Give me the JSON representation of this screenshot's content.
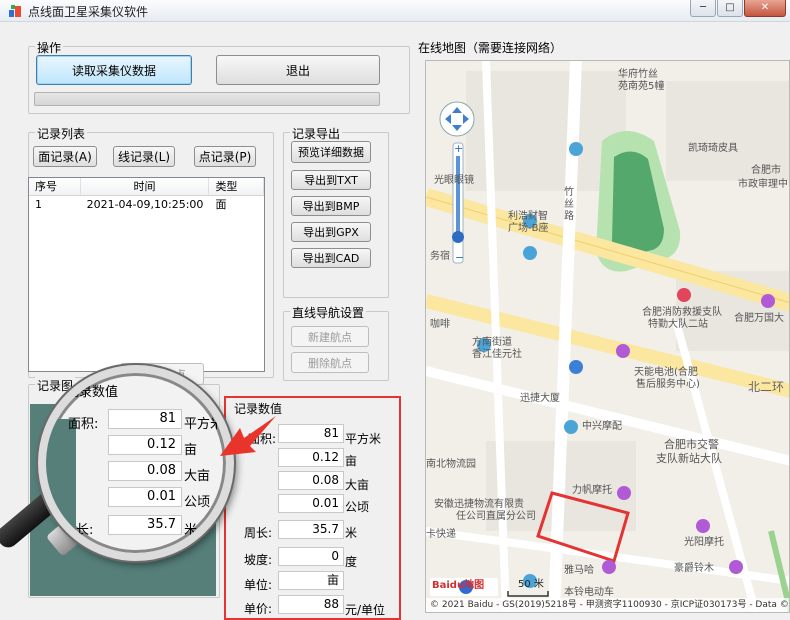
{
  "window": {
    "title": "点线面卫星采集仪软件",
    "minimize": "─",
    "maximize": "□",
    "close": "✕"
  },
  "operation": {
    "label": "操作",
    "read_button": "读取采集仪数据",
    "exit_button": "退出",
    "progress": 0
  },
  "record_list": {
    "label": "记录列表",
    "buttons": [
      "面记录(A)",
      "线记录(L)",
      "点记录(P)"
    ],
    "columns": [
      "序号",
      "时间",
      "类型"
    ],
    "rows": [
      {
        "id": "1",
        "time": "2021-04-09,10:25:00",
        "type": "面"
      }
    ]
  },
  "record_export": {
    "label": "记录导出",
    "buttons": [
      "预览详细数据",
      "导出到TXT",
      "导出到BMP",
      "导出到GPX",
      "导出到CAD"
    ]
  },
  "navigation": {
    "label": "直线导航设置",
    "new_waypoint": "新建航点",
    "delete_waypoint": "删除航点"
  },
  "record_image": {
    "label": "记录图"
  },
  "record_values": {
    "label": "记录数值",
    "area": {
      "label": "面积:",
      "value": "81",
      "unit": "平方米"
    },
    "mu1": {
      "value": "0.12",
      "unit": "亩"
    },
    "big_mu": {
      "value": "0.08",
      "unit": "大亩"
    },
    "hectare": {
      "value": "0.01",
      "unit": "公顷"
    },
    "perimeter": {
      "label": "周长:",
      "value": "35.7",
      "unit": "米"
    },
    "slope": {
      "label": "坡度:",
      "value": "0",
      "unit": "度"
    },
    "unit_row": {
      "label": "单位:",
      "value": "亩"
    },
    "price": {
      "label": "单价:",
      "value": "88",
      "unit": "元/单位"
    }
  },
  "magnifier": {
    "title": "记录数值",
    "area_label": "面积:",
    "area_value": "81",
    "area_unit": "平方米",
    "mu_value": "0.12",
    "mu_unit": "亩",
    "big_mu_value": "0.08",
    "big_mu_unit": "大亩",
    "hectare_value": "0.01",
    "hectare_unit": "公顷",
    "perimeter_label": "长:",
    "perimeter_value": "35.7",
    "perimeter_unit": "米"
  },
  "map": {
    "label": "在线地图（需要连接网络）",
    "labels": [
      "华府竹丝",
      "苑南苑5幢",
      "凯琦琦皮具",
      "合肥市",
      "市政审理中",
      "光眼眼镜",
      "竹丝路",
      "利浩财智",
      "广场-B座",
      "务宿",
      "合肥消防救援支队",
      "特勤大队二站",
      "合肥万国大",
      "咖啡",
      "方南街道",
      "香江佳元社",
      "天能电池(合肥",
      "售后服务中心)",
      "北二环",
      "迅捷大厦",
      "中兴摩配",
      "合肥市交警",
      "支队新站大队",
      "南北物流园",
      "力帆摩托",
      "安徽迅捷物流有限责",
      "任公司直属分公司",
      "光阳摩托",
      "卡快递",
      "雅马哈",
      "豪爵铃木",
      "本铃电动车"
    ],
    "scale": "50 米",
    "logo": "Baidu地图",
    "copyright": "© 2021 Baidu - GS(2019)5218号 - 甲测资字1100930 - 京ICP证030173号 - Data ©",
    "colors": {
      "road": "#fbe7a0",
      "park": "#b6e2b0",
      "highlight": "#e53232"
    }
  }
}
